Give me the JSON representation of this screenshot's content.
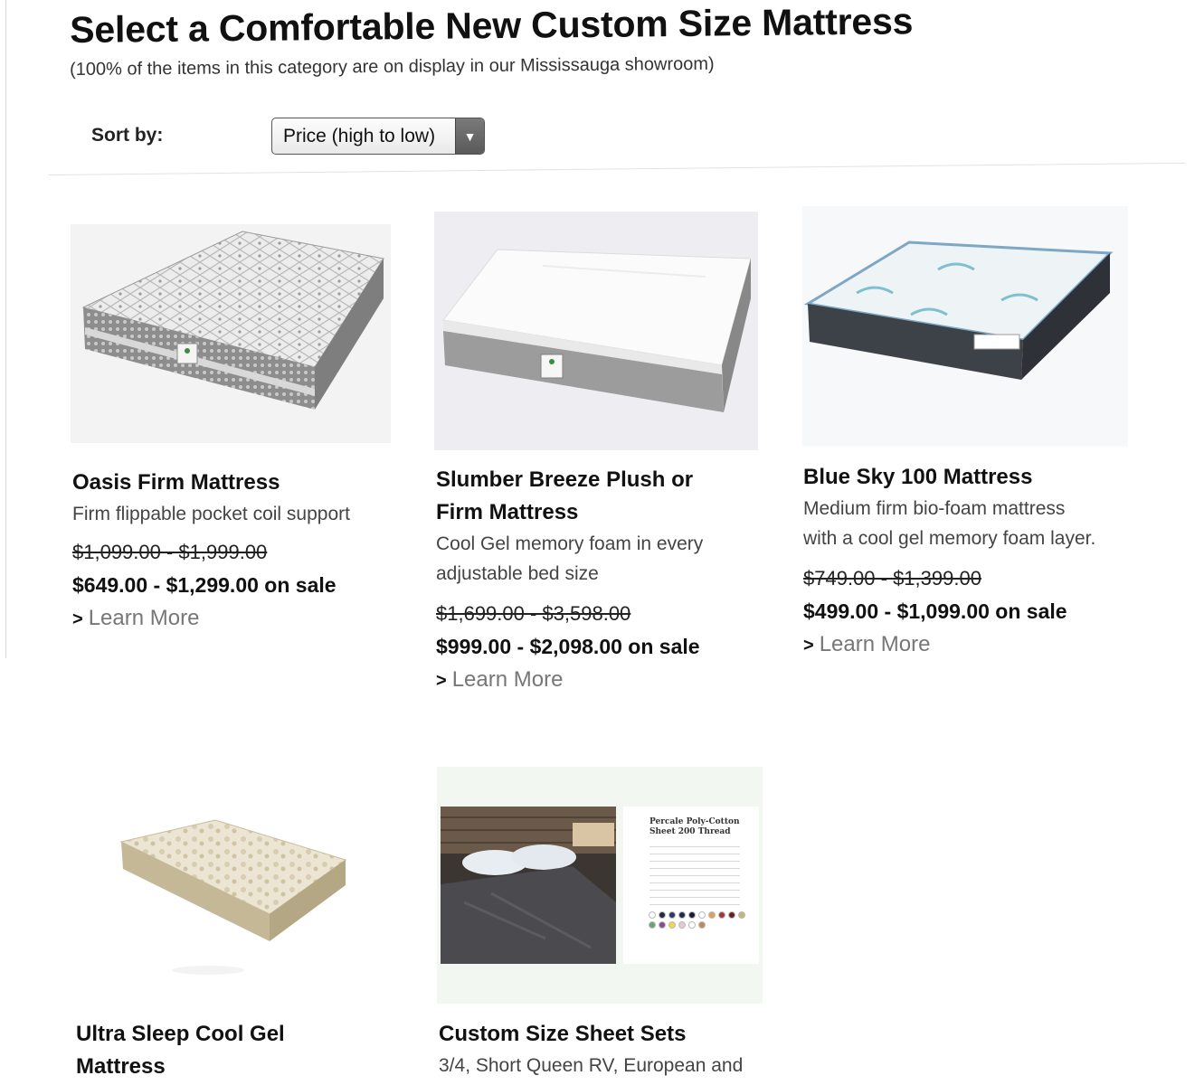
{
  "page": {
    "title": "Select a Comfortable New Custom Size Mattress",
    "subtitle": "(100% of the items in this category are on display in our Mississauga showroom)"
  },
  "sort": {
    "label": "Sort by:",
    "selected": "Price (high to low)",
    "arrow_icon": "triangle-down-icon"
  },
  "products": [
    {
      "title_lines": [
        "Oasis Firm Mattress"
      ],
      "desc_lines": [
        "Firm flippable pocket coil support"
      ],
      "price_old": "$1,099.00 - $1,999.00",
      "price_sale": "$649.00 - $1,299.00 on sale",
      "learn_more": "Learn More"
    },
    {
      "title_lines": [
        "Slumber Breeze Plush or",
        "Firm Mattress"
      ],
      "desc_lines": [
        "Cool Gel memory foam in every",
        "adjustable bed size"
      ],
      "price_old": "$1,699.00 - $3,598.00",
      "price_sale": "$999.00 - $2,098.00 on sale",
      "learn_more": "Learn More"
    },
    {
      "title_lines": [
        "Blue Sky 100 Mattress"
      ],
      "desc_lines": [
        "Medium firm bio-foam mattress",
        "with a cool gel memory foam layer."
      ],
      "price_old": "$749.00 - $1,399.00",
      "price_sale": "$499.00 - $1,099.00 on sale",
      "learn_more": "Learn More"
    },
    {
      "title_lines": [
        "Ultra Sleep Cool Gel",
        "Mattress"
      ]
    },
    {
      "title_lines": [
        "Custom Size Sheet Sets"
      ],
      "desc_lines": [
        "3/4, Short Queen RV, European and"
      ]
    }
  ],
  "sheet_flyer": {
    "heading_lines": [
      "Percale Poly-Cotton",
      "Sheet 200 Thread"
    ],
    "swatch_colors": [
      "#ffffff",
      "#1f2a44",
      "#2b3a67",
      "#1d2b4f",
      "#141d33",
      "#ffffff",
      "#d9a15a",
      "#a43a2f",
      "#6b1e24",
      "#c9b27c",
      "#6aa36f",
      "#8a4b8f",
      "#f1d84a",
      "#e7c7d8",
      "#ffffff",
      "#b98b5e"
    ],
    "learn_more_chevron_icon": "chevron-right-icon"
  }
}
